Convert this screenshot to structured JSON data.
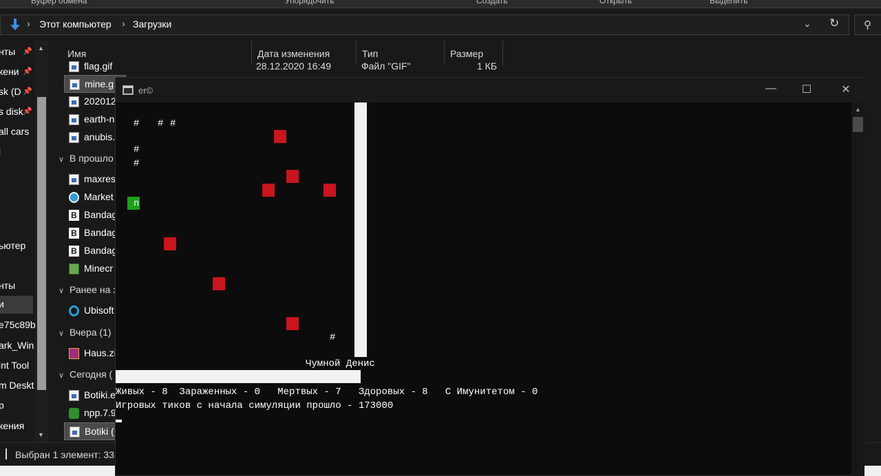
{
  "ribbon": {
    "groups": [
      "Буфер обмена",
      "Упорядочить",
      "Создать",
      "Открыть",
      "Выделить"
    ]
  },
  "address": {
    "crumbs": [
      "Этот компьютер",
      "Загрузки"
    ]
  },
  "nav_pane": {
    "items": [
      "нты",
      "кени",
      "sk (D",
      "s disk",
      "all cars",
      "i",
      "ьютер",
      "нты",
      "и",
      "e75c89b",
      "ark_Win",
      "int Tool",
      "m Deskt",
      "p",
      "кения"
    ]
  },
  "files": {
    "columns": [
      "Имя",
      "Дата изменения",
      "Тип",
      "Размер"
    ],
    "rows_top": [
      {
        "name": "flag.gif",
        "date": "28.12.2020 16:49",
        "type": "Файл \"GIF\"",
        "size": "1 КБ"
      },
      {
        "name": "mine.g"
      },
      {
        "name": "202012"
      },
      {
        "name": "earth-n"
      },
      {
        "name": "anubis."
      }
    ],
    "group_prev": "В прошло",
    "rows_prev": [
      "maxres",
      "Market",
      "Bandag",
      "Bandag",
      "Bandag",
      "Minecr"
    ],
    "group_earlier": "Ранее на з",
    "rows_earlier": [
      "Ubisoft"
    ],
    "group_yesterday": "Вчера (1)",
    "rows_yesterday": [
      "Haus.zi"
    ],
    "group_today": "Сегодня (",
    "rows_today": [
      "Botiki.e",
      "npp.7.9",
      "Botiki ("
    ]
  },
  "status_bar": {
    "text": "Выбран 1 элемент: 33"
  },
  "console": {
    "title": "er©",
    "buttons": {
      "minimize": "—",
      "maximize": "☐",
      "close": "✕"
    },
    "hash_char": "#",
    "healthy_char": "п",
    "name_label": "Чумной Денис",
    "stats_line": "Живых - 8  Зараженных - 0   Мертвых - 7   Здоровых - 8   С Имунитетом - 0",
    "ticks_line": "Игровых тиков с начала симуляции прошло - 173000"
  },
  "colors": {
    "infected": "#c8151e",
    "healthy": "#1e9f1e",
    "wall": "#f2f2f2",
    "console_bg": "#0c0c0c"
  }
}
